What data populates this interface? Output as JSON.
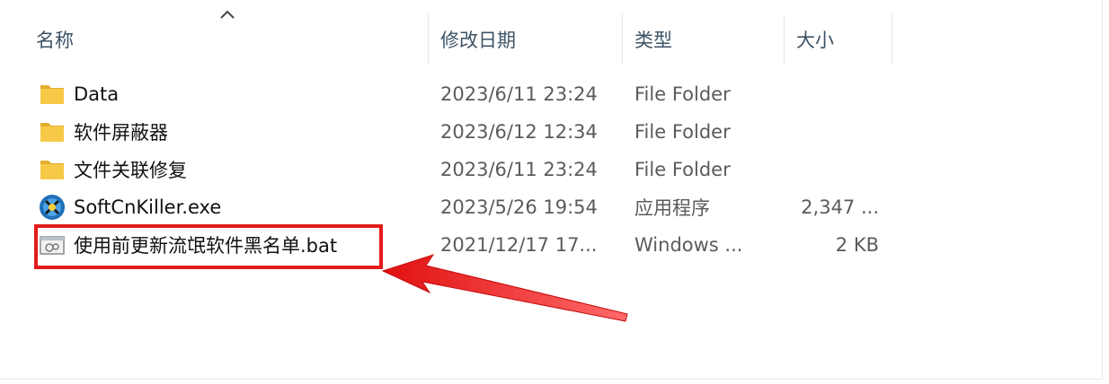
{
  "columns": {
    "name": "名称",
    "date": "修改日期",
    "type": "类型",
    "size": "大小"
  },
  "files": [
    {
      "name": "Data",
      "date": "2023/6/11 23:24",
      "type": "File Folder",
      "size": "",
      "icon": "folder-icon"
    },
    {
      "name": "软件屏蔽器",
      "date": "2023/6/12 12:34",
      "type": "File Folder",
      "size": "",
      "icon": "folder-icon"
    },
    {
      "name": "文件关联修复",
      "date": "2023/6/11 23:24",
      "type": "File Folder",
      "size": "",
      "icon": "folder-icon"
    },
    {
      "name": "SoftCnKiller.exe",
      "date": "2023/5/26 19:54",
      "type": "应用程序",
      "size": "2,347 ...",
      "icon": "app-exe-icon"
    },
    {
      "name": "使用前更新流氓软件黑名单.bat",
      "date": "2021/12/17 17...",
      "type": "Windows ...",
      "size": "2 KB",
      "icon": "batch-file-icon"
    }
  ],
  "colors": {
    "header_text": "#3d5366",
    "highlight": "#e31b1b",
    "folder": "#f5c440"
  }
}
